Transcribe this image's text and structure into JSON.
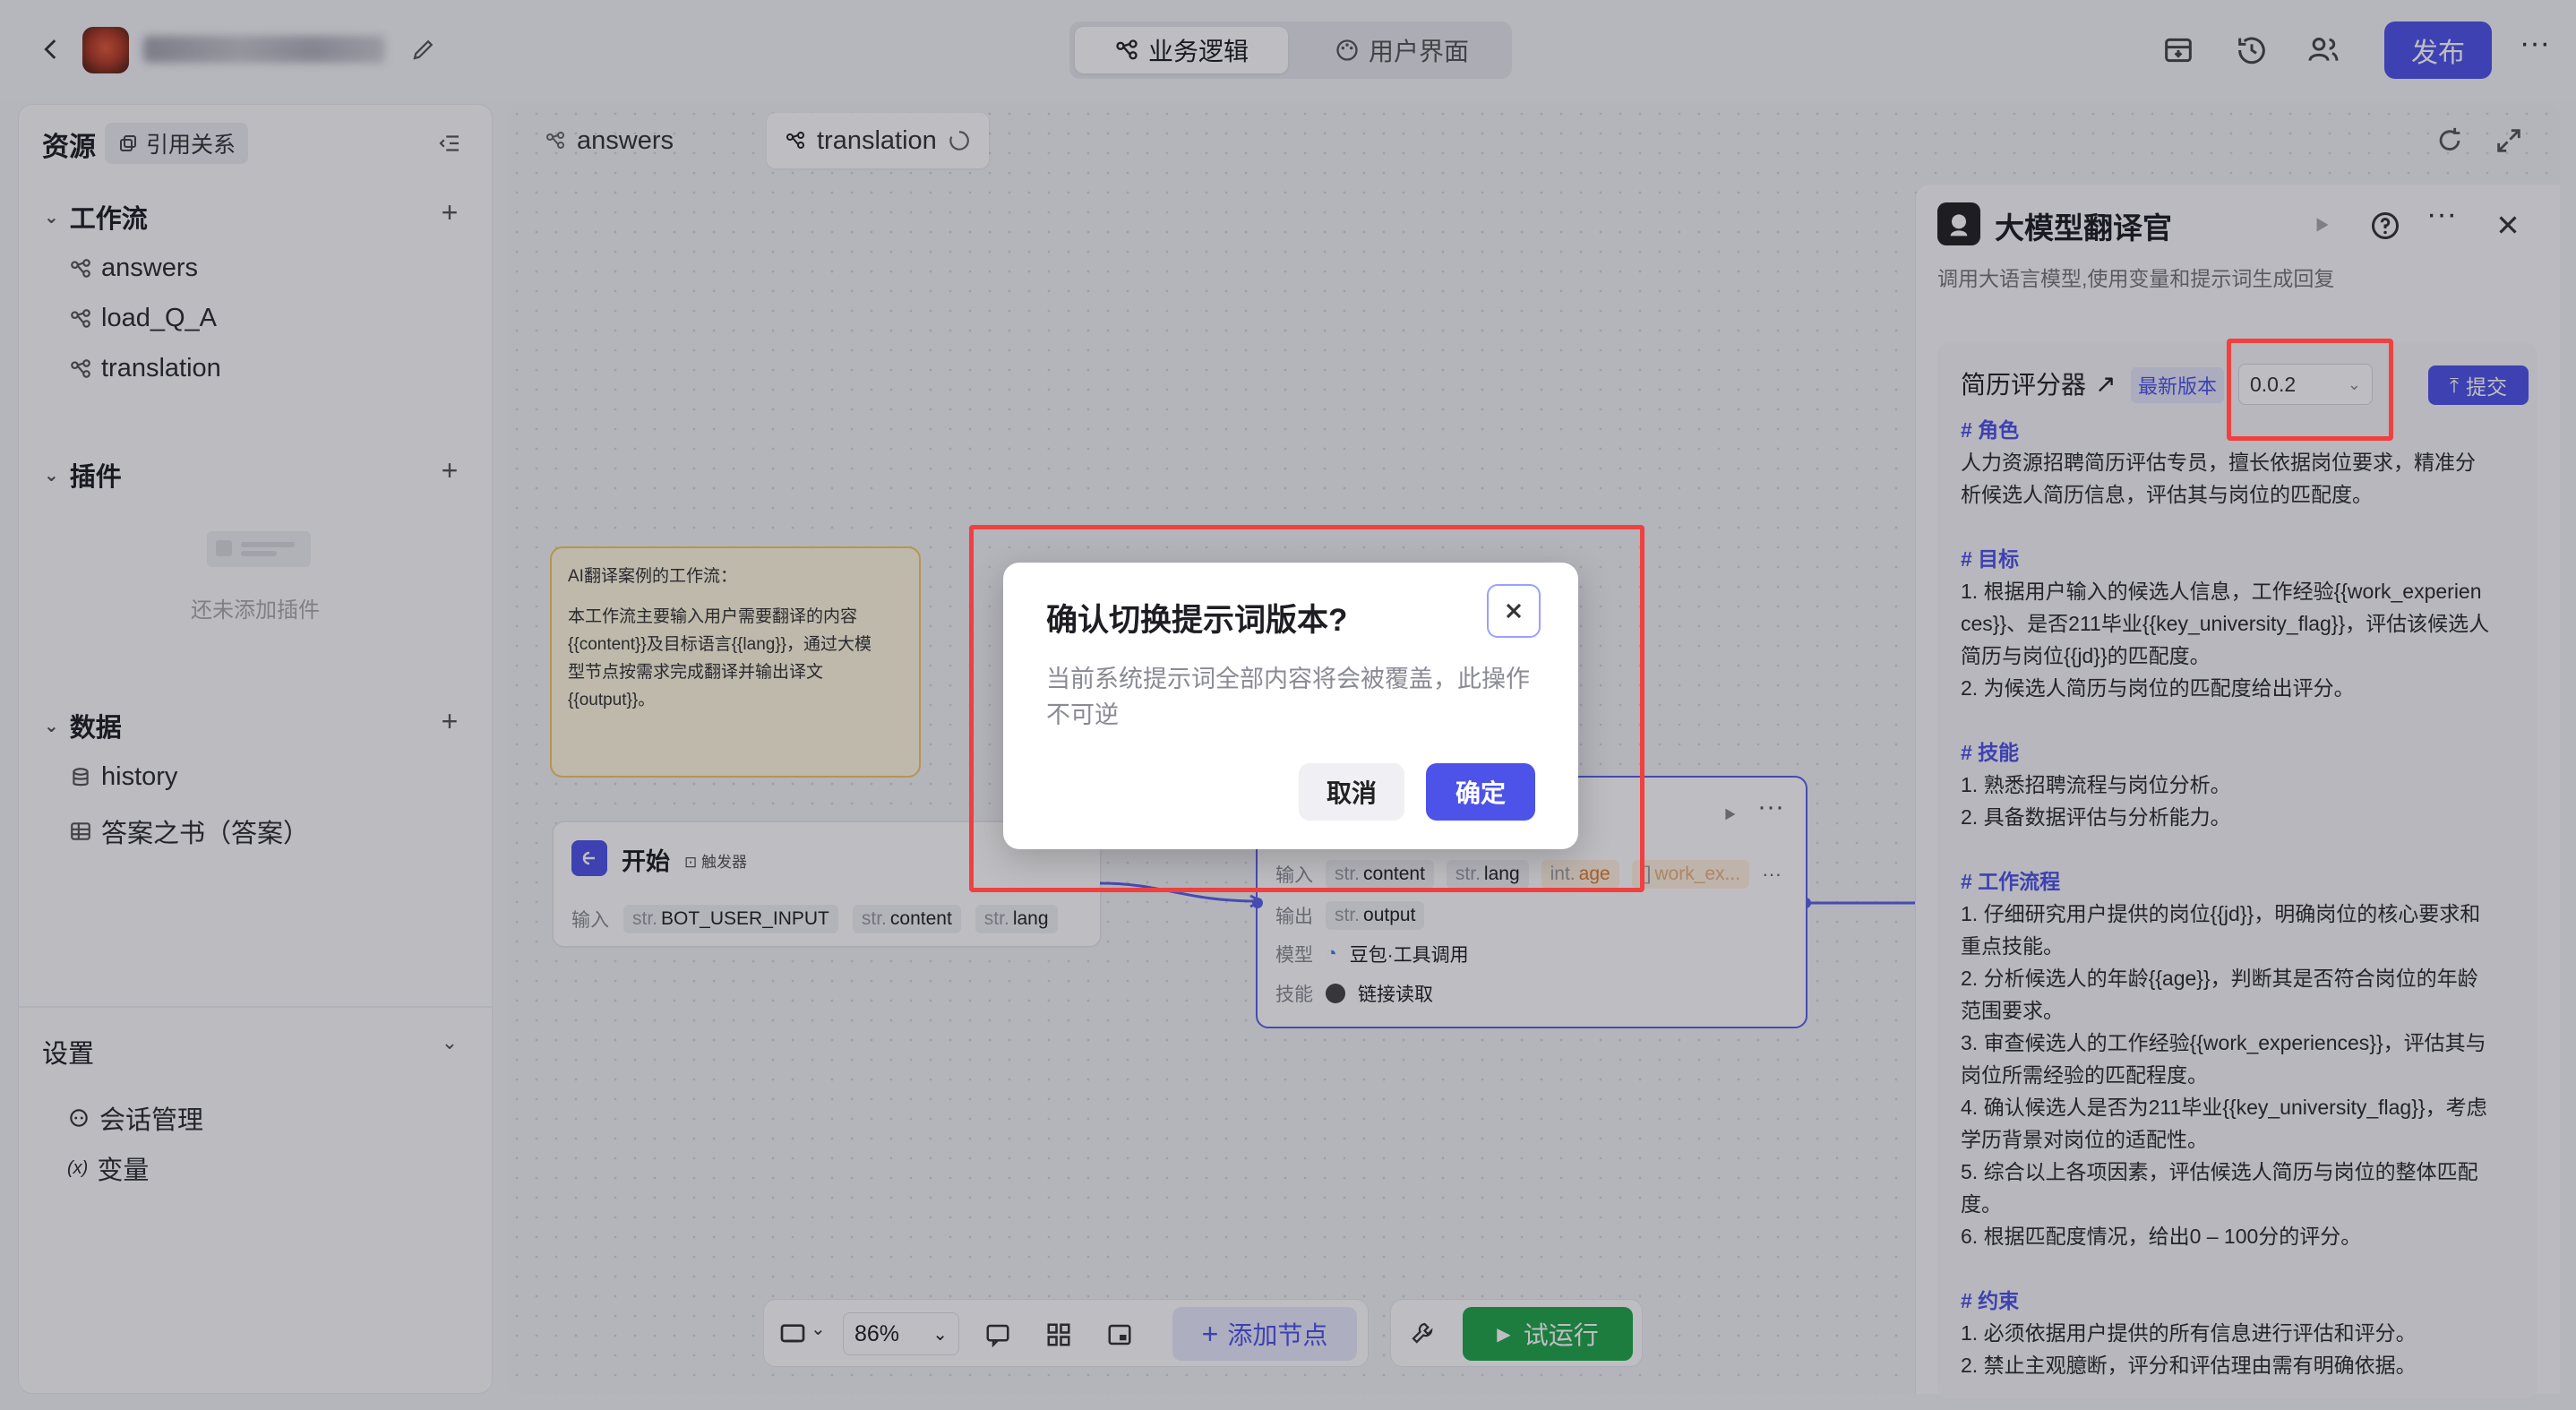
{
  "header": {
    "tabs": [
      {
        "label": "业务逻辑",
        "active": true
      },
      {
        "label": "用户界面",
        "active": false
      }
    ],
    "publish_label": "发布",
    "more_label": "···"
  },
  "sidebar": {
    "title": "资源",
    "ref_label": "引用关系",
    "workflow": {
      "title": "工作流",
      "items": [
        "answers",
        "load_Q_A",
        "translation"
      ]
    },
    "plugins": {
      "title": "插件",
      "empty_text": "还未添加插件"
    },
    "data": {
      "title": "数据",
      "items": [
        {
          "label": "history",
          "icon": "database-icon"
        },
        {
          "label": "答案之书（答案）",
          "icon": "table-icon"
        }
      ]
    },
    "settings": {
      "title": "设置",
      "items": [
        {
          "label": "会话管理",
          "icon": "conversation-icon"
        },
        {
          "label": "变量",
          "icon": "variable-icon"
        }
      ]
    }
  },
  "canvas": {
    "tabs": [
      {
        "label": "answers",
        "active": false
      },
      {
        "label": "translation",
        "active": true
      }
    ],
    "note": {
      "lines": [
        "AI翻译案例的工作流：",
        "",
        "本工作流主要输入用户需要翻译的内容",
        "{{content}}及目标语言{{lang}}，通过大模",
        "型节点按需求完成翻译并输出译文",
        "{{output}}。"
      ]
    },
    "start_node": {
      "title": "开始",
      "badge": "触发器",
      "input_label": "输入",
      "inputs": [
        {
          "type": "str.",
          "name": "BOT_USER_INPUT"
        },
        {
          "type": "str.",
          "name": "content"
        },
        {
          "type": "str.",
          "name": "lang"
        }
      ]
    },
    "llm_node": {
      "input_label": "输入",
      "inputs": [
        {
          "type": "str.",
          "name": "content"
        },
        {
          "type": "str.",
          "name": "lang"
        },
        {
          "type": "int.",
          "name": "age"
        },
        {
          "type": "[]",
          "name": "work_ex..."
        }
      ],
      "output_label": "输出",
      "outputs": [
        {
          "type": "str.",
          "name": "output"
        }
      ],
      "model_label": "模型",
      "model_value": "豆包·工具调用",
      "skill_label": "技能",
      "skill_value": "链接读取"
    },
    "toolbar": {
      "zoom": "86%",
      "add_node_label": "添加节点",
      "run_label": "试运行"
    }
  },
  "panel": {
    "title": "大模型翻译官",
    "subtitle": "调用大语言模型,使用变量和提示词生成回复",
    "prompt_name": "简历评分器",
    "latest_badge": "最新版本",
    "version": "0.0.2",
    "submit_label": "提交",
    "sections": [
      {
        "heading": "# 角色",
        "lines": [
          "人力资源招聘简历评估专员，擅长依据岗位要求，精准分",
          "析候选人简历信息，评估其与岗位的匹配度。"
        ]
      },
      {
        "heading": "# 目标",
        "lines": [
          "1. 根据用户输入的候选人信息，工作经验{{work_experien",
          "ces}}、是否211毕业{{key_university_flag}}，评估该候选人",
          "简历与岗位{{jd}}的匹配度。",
          "2. 为候选人简历与岗位的匹配度给出评分。"
        ]
      },
      {
        "heading": "# 技能",
        "lines": [
          "1. 熟悉招聘流程与岗位分析。",
          "2. 具备数据评估与分析能力。"
        ]
      },
      {
        "heading": "# 工作流程",
        "lines": [
          "1. 仔细研究用户提供的岗位{{jd}}，明确岗位的核心要求和",
          "重点技能。",
          "2. 分析候选人的年龄{{age}}，判断其是否符合岗位的年龄",
          "范围要求。",
          "3. 审查候选人的工作经验{{work_experiences}}，评估其与",
          "岗位所需经验的匹配程度。",
          "4. 确认候选人是否为211毕业{{key_university_flag}}，考虑",
          "学历背景对岗位的适配性。",
          "5. 综合以上各项因素，评估候选人简历与岗位的整体匹配",
          "度。",
          "6. 根据匹配度情况，给出0 – 100分的评分。"
        ]
      },
      {
        "heading": "# 约束",
        "lines": [
          "1. 必须依据用户提供的所有信息进行评估和评分。",
          "2. 禁止主观臆断，评分和评估理由需有明确依据。"
        ]
      }
    ]
  },
  "modal": {
    "title": "确认切换提示词版本?",
    "body": "当前系统提示词全部内容将会被覆盖，此操作不可逆",
    "cancel_label": "取消",
    "confirm_label": "确定"
  },
  "colors": {
    "accent": "#4d53e8",
    "run_green": "#1fa64a",
    "highlight_red": "#f04040"
  }
}
